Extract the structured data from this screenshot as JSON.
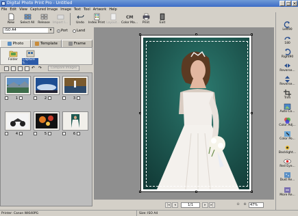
{
  "window": {
    "title": "Digital Photo Print Pro - Untitled",
    "buttons": [
      "_",
      "□",
      "×"
    ]
  },
  "menu": [
    "File",
    "Edit",
    "View",
    "Captured Image",
    "Image",
    "Text",
    "Tool",
    "Artwork",
    "Help"
  ],
  "toolbar": [
    {
      "label": "New",
      "icon": "new-icon",
      "enabled": true
    },
    {
      "label": "Select All",
      "icon": "select-all-icon",
      "enabled": true
    },
    {
      "label": "Release",
      "icon": "release-icon",
      "enabled": true
    },
    {
      "label": "Import I...",
      "icon": "import-icon",
      "enabled": false
    },
    {
      "label": "Undo",
      "icon": "undo-icon",
      "enabled": true
    },
    {
      "label": "Index Print",
      "icon": "index-print-icon",
      "enabled": true
    },
    {
      "label": "Layout...",
      "icon": "layout-icon",
      "enabled": false
    },
    {
      "label": "Color Ma...",
      "icon": "color-management-icon",
      "enabled": true
    },
    {
      "label": "Print",
      "icon": "print-icon",
      "enabled": true
    },
    {
      "label": "Exit",
      "icon": "exit-icon",
      "enabled": true
    }
  ],
  "paper": {
    "size": "ISO A4",
    "orientation_options": [
      "Port",
      "Land"
    ],
    "selected_orientation": "Port"
  },
  "tabs": [
    {
      "label": "Photo",
      "active": true
    },
    {
      "label": "Template",
      "active": false
    },
    {
      "label": "Frame",
      "active": false
    }
  ],
  "folders": [
    {
      "label": "Folder",
      "icon": "folder-icon"
    },
    {
      "label": "Capture S...",
      "icon": "capture-sheet-icon"
    }
  ],
  "compare_button": "Compare Images",
  "thumbnails": [
    {
      "num": "1",
      "scene": "landscape"
    },
    {
      "num": "2",
      "scene": "sky"
    },
    {
      "num": "3",
      "scene": "lighthouse"
    },
    {
      "num": "4",
      "scene": "motorcycle"
    },
    {
      "num": "5",
      "scene": "fireworks"
    },
    {
      "num": "6",
      "scene": "bride"
    }
  ],
  "navigation": {
    "page": "1/1",
    "zoom": "47%"
  },
  "right_tools": [
    {
      "label": "Left90",
      "icon": "rotate-left-icon"
    },
    {
      "label": "180",
      "icon": "rotate-180-icon"
    },
    {
      "label": "Right90",
      "icon": "rotate-right-icon"
    },
    {
      "label": "Reverse...",
      "icon": "reverse-horizontal-icon"
    },
    {
      "label": "Reverse...",
      "icon": "reverse-vertical-icon"
    },
    {
      "label": "Trim",
      "icon": "trim-icon"
    },
    {
      "label": "Auto Co...",
      "icon": "auto-correct-icon"
    },
    {
      "label": "Color Adj...",
      "icon": "color-adjust-icon"
    },
    {
      "label": "Color Po...",
      "icon": "color-point-icon"
    },
    {
      "label": "Backlight...",
      "icon": "backlight-icon"
    },
    {
      "label": "Red Eye...",
      "icon": "red-eye-icon"
    },
    {
      "label": "Dust Re...",
      "icon": "dust-removal-icon"
    },
    {
      "label": "More Re...",
      "icon": "more-icon"
    }
  ],
  "status": {
    "printer": "Printer: Canon Wi640PG",
    "size": "Size: ISO A4"
  },
  "colors": {
    "title_bar": "#3c6cc6",
    "canvas_bg": "#8f8f8f",
    "photo_bg": "#1d5a52"
  }
}
